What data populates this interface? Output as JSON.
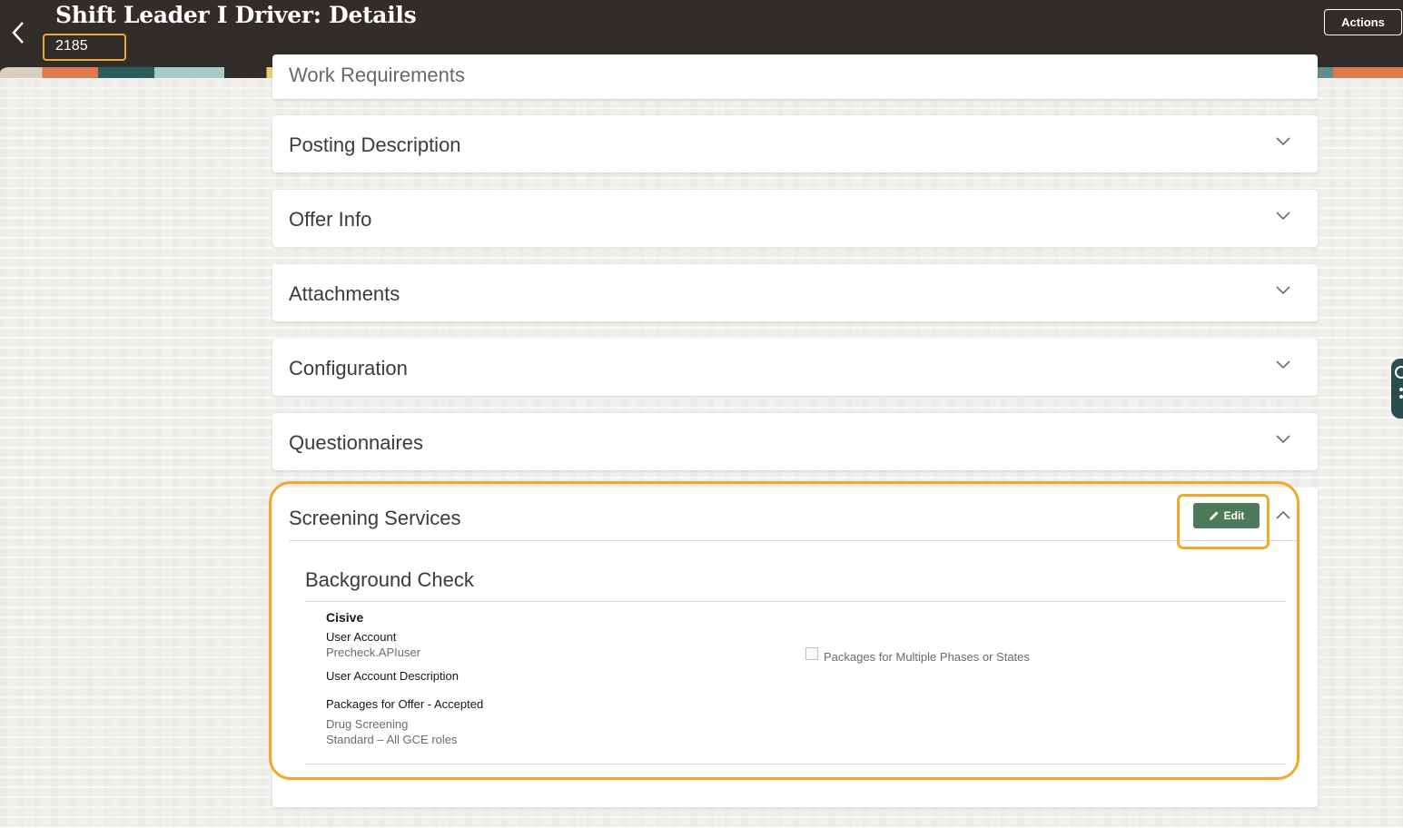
{
  "header": {
    "title": "Shift Leader I Driver: Details",
    "requisition_id": "2185",
    "actions_label": "Actions"
  },
  "sections": {
    "clipped_label": "Work Requirements",
    "posting_description": "Posting Description",
    "offer_info": "Offer Info",
    "attachments": "Attachments",
    "configuration": "Configuration",
    "questionnaires": "Questionnaires"
  },
  "screening": {
    "title": "Screening Services",
    "edit_label": "Edit",
    "subsection_title": "Background Check",
    "provider": "Cisive",
    "user_account_label": "User Account",
    "user_account_value": "Precheck.APIuser",
    "user_account_desc_label": "User Account Description",
    "packages_offer_label": "Packages for Offer - Accepted",
    "packages": [
      "Drug Screening",
      "Standard – All GCE roles"
    ],
    "multi_phase_label": "Packages for Multiple Phases or States",
    "multi_phase_checked": false
  },
  "colors": {
    "header_bg": "#312d2a",
    "highlight": "#f0a92d",
    "edit_button": "#4d7a59"
  }
}
